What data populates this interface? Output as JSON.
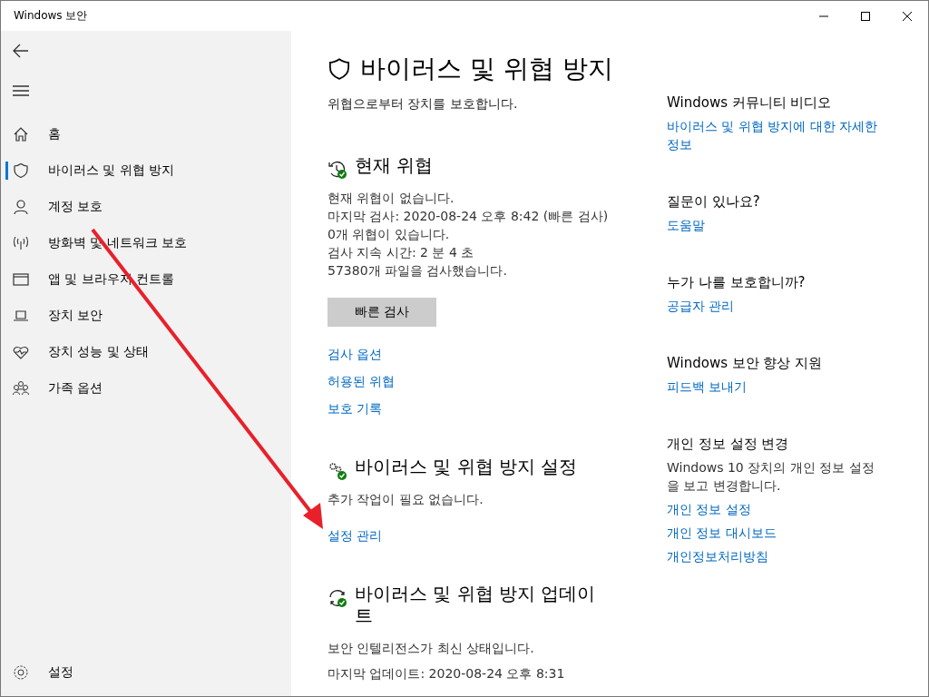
{
  "window": {
    "title": "Windows 보안"
  },
  "sidebar": {
    "items": [
      {
        "label": "홈",
        "selected": false
      },
      {
        "label": "바이러스 및 위협 방지",
        "selected": true
      },
      {
        "label": "계정 보호",
        "selected": false
      },
      {
        "label": "방화벽 및 네트워크 보호",
        "selected": false
      },
      {
        "label": "앱 및 브라우저 컨트롤",
        "selected": false
      },
      {
        "label": "장치 보안",
        "selected": false
      },
      {
        "label": "장치 성능 및 상태",
        "selected": false
      },
      {
        "label": "가족 옵션",
        "selected": false
      }
    ],
    "settings": "설정"
  },
  "page": {
    "title": "바이러스 및 위협 방지",
    "subtitle": "위협으로부터 장치를 보호합니다."
  },
  "sections": [
    {
      "title": "현재 위협",
      "lines": [
        "현재 위협이 없습니다.",
        "마지막 검사: 2020-08-24 오후 8:42 (빠른 검사)",
        "0개 위협이 있습니다.",
        "검사 지속 시간: 2 분 4 초",
        "57380개 파일을 검사했습니다."
      ],
      "button": "빠른 검사",
      "links": [
        "검사 옵션",
        "허용된 위협",
        "보호 기록"
      ]
    },
    {
      "title": "바이러스 및 위협 방지 설정",
      "lines": [
        "추가 작업이 필요 없습니다."
      ],
      "links": [
        "설정 관리"
      ]
    },
    {
      "title": "바이러스 및 위협 방지 업데이트",
      "lines": [
        "보안 인텔리전스가 최신 상태입니다.",
        "마지막 업데이트: 2020-08-24 오후 8:31"
      ]
    }
  ],
  "side_panel": [
    {
      "heading": "Windows 커뮤니티 비디오",
      "links": [
        "바이러스 및 위협 방지에 대한 자세한 정보"
      ]
    },
    {
      "heading": "질문이 있나요?",
      "links": [
        "도움말"
      ]
    },
    {
      "heading": "누가 나를 보호합니까?",
      "links": [
        "공급자 관리"
      ]
    },
    {
      "heading": "Windows 보안 향상 지원",
      "links": [
        "피드백 보내기"
      ]
    },
    {
      "heading": "개인 정보 설정 변경",
      "text": "Windows 10 장치의 개인 정보 설정을 보고 변경합니다.",
      "links": [
        "개인 정보 설정",
        "개인 정보 대시보드",
        "개인정보처리방침"
      ]
    }
  ]
}
